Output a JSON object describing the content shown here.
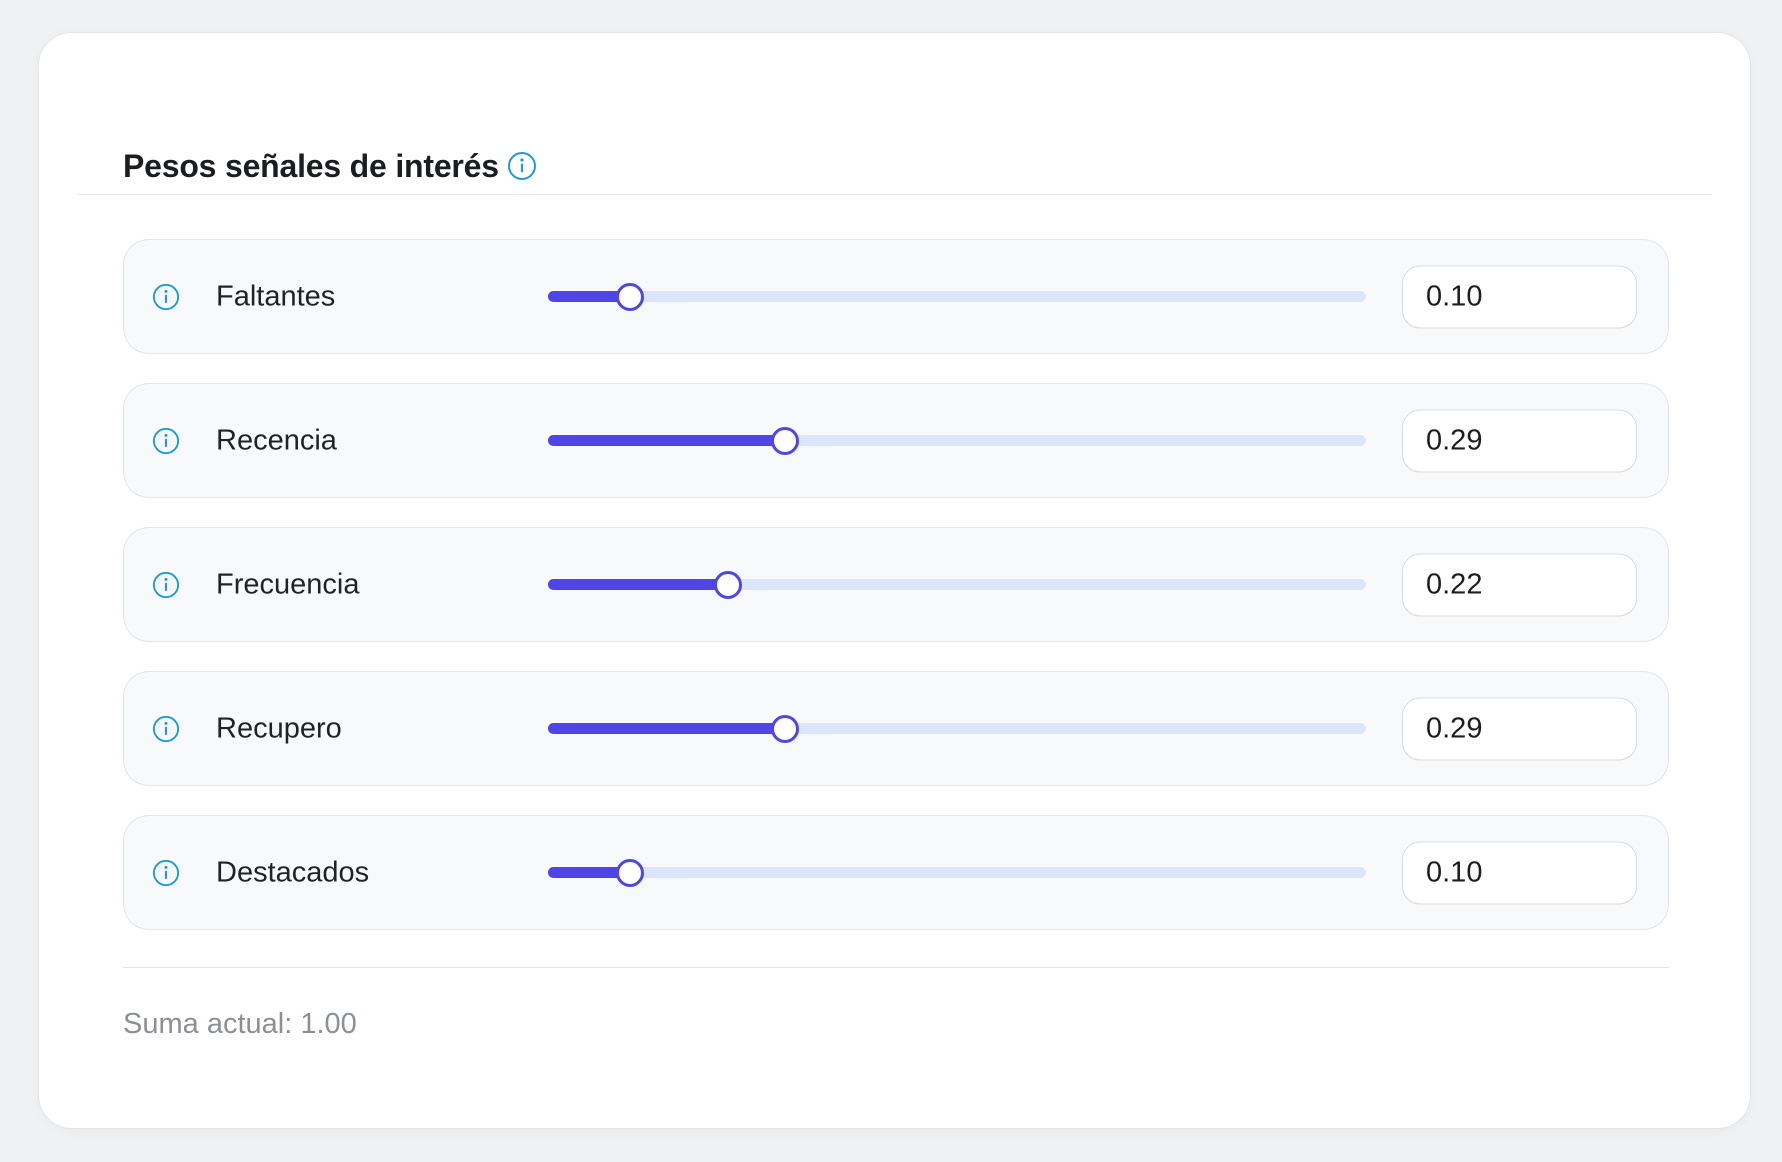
{
  "card": {
    "title": "Pesos señales de interés"
  },
  "colors": {
    "accent": "#4f46e5",
    "track": "#dce6fb",
    "info_icon": "#1d9bd8"
  },
  "signals": [
    {
      "label": "Faltantes",
      "value": "0.10",
      "fraction": 0.1
    },
    {
      "label": "Recencia",
      "value": "0.29",
      "fraction": 0.29
    },
    {
      "label": "Frecuencia",
      "value": "0.22",
      "fraction": 0.22
    },
    {
      "label": "Recupero",
      "value": "0.29",
      "fraction": 0.29
    },
    {
      "label": "Destacados",
      "value": "0.10",
      "fraction": 0.1
    }
  ],
  "footer": {
    "sum_text": "Suma actual: 1.00"
  },
  "icons": {
    "info": "info-icon"
  }
}
